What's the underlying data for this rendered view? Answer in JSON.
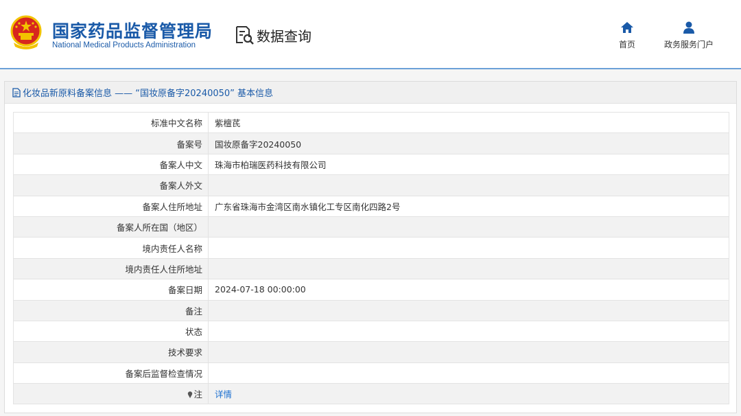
{
  "header": {
    "org_name_cn": "国家药品监督管理局",
    "org_name_en": "National Medical Products Administration",
    "search_title": "数据查询",
    "nav": {
      "home_label": "首页",
      "portal_label": "政务服务门户"
    }
  },
  "panel": {
    "title": "化妆品新原料备案信息 —— “国妆原备字20240050” 基本信息",
    "rows": [
      {
        "label": "标准中文名称",
        "value": "紫檀芪"
      },
      {
        "label": "备案号",
        "value": "国妆原备字20240050"
      },
      {
        "label": "备案人中文",
        "value": "珠海市柏瑞医药科技有限公司"
      },
      {
        "label": "备案人外文",
        "value": ""
      },
      {
        "label": "备案人住所地址",
        "value": "广东省珠海市金湾区南水镇化工专区南化四路2号"
      },
      {
        "label": "备案人所在国（地区）",
        "value": ""
      },
      {
        "label": "境内责任人名称",
        "value": ""
      },
      {
        "label": "境内责任人住所地址",
        "value": ""
      },
      {
        "label": "备案日期",
        "value": "2024-07-18 00:00:00"
      },
      {
        "label": "备注",
        "value": ""
      },
      {
        "label": "状态",
        "value": ""
      },
      {
        "label": "技术要求",
        "value": ""
      },
      {
        "label": "备案后监督检查情况",
        "value": ""
      }
    ],
    "note_row": {
      "label": "注",
      "link_label": "详情"
    }
  },
  "colors": {
    "brand_blue": "#1a5aa8",
    "link_blue": "#1a6fd0",
    "emblem_red": "#d7261e",
    "emblem_gold": "#f2c300"
  },
  "icons": {
    "emblem": "national-emblem-icon",
    "search": "document-search-icon",
    "home": "home-icon",
    "portal": "user-icon",
    "title": "document-icon",
    "note": "pin-icon"
  }
}
